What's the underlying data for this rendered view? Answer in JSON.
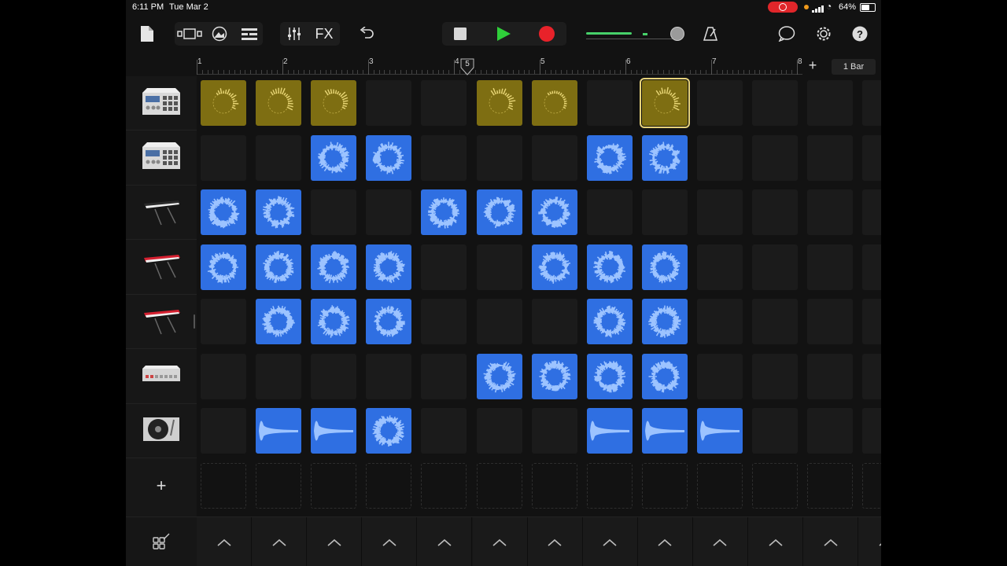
{
  "status_bar": {
    "time": "6:11 PM",
    "date": "Tue Mar 2",
    "battery": "64%",
    "battery_level": 0.64
  },
  "toolbar": {
    "fx_label": "FX"
  },
  "ruler": {
    "bars": [
      "1",
      "2",
      "3",
      "4",
      "5",
      "6",
      "7",
      "8"
    ],
    "playhead_bar": 5,
    "bar_length_label": "1 Bar"
  },
  "tracks": [
    {
      "instrument": "drum-machine",
      "icon": "drum-machine-icon"
    },
    {
      "instrument": "drum-machine",
      "icon": "drum-machine-icon"
    },
    {
      "instrument": "keyboard-black",
      "icon": "keyboard-icon"
    },
    {
      "instrument": "keyboard-red",
      "icon": "keyboard-icon"
    },
    {
      "instrument": "keyboard-red",
      "icon": "keyboard-icon"
    },
    {
      "instrument": "beat-sequencer",
      "icon": "beat-sequencer-icon"
    },
    {
      "instrument": "turntable",
      "icon": "turntable-icon"
    }
  ],
  "add_track_label": "+",
  "cells": [
    [
      "gold",
      "gold",
      "gold",
      "",
      "",
      "gold",
      "gold",
      "",
      "gold-sel",
      "",
      "",
      ""
    ],
    [
      "",
      "",
      "blue",
      "blue",
      "",
      "",
      "",
      "blue",
      "blue",
      "",
      "",
      ""
    ],
    [
      "blue",
      "blue",
      "",
      "",
      "blue",
      "blue",
      "blue",
      "",
      "",
      "",
      "",
      ""
    ],
    [
      "blue",
      "blue",
      "blue",
      "blue",
      "",
      "",
      "blue",
      "blue",
      "blue",
      "",
      "",
      ""
    ],
    [
      "",
      "blue",
      "blue",
      "blue",
      "",
      "",
      "",
      "blue",
      "blue",
      "",
      "",
      ""
    ],
    [
      "",
      "",
      "",
      "",
      "",
      "blue",
      "blue",
      "blue",
      "blue",
      "",
      "",
      ""
    ],
    [
      "",
      "blue-wave",
      "blue-wave",
      "blue",
      "",
      "",
      "",
      "blue-wave",
      "blue-wave",
      "blue-wave",
      "",
      ""
    ]
  ],
  "colors": {
    "blue": "#2f6fe2",
    "gold": "#7e6e12",
    "record": "#e8222a",
    "play": "#2fcf3a"
  }
}
